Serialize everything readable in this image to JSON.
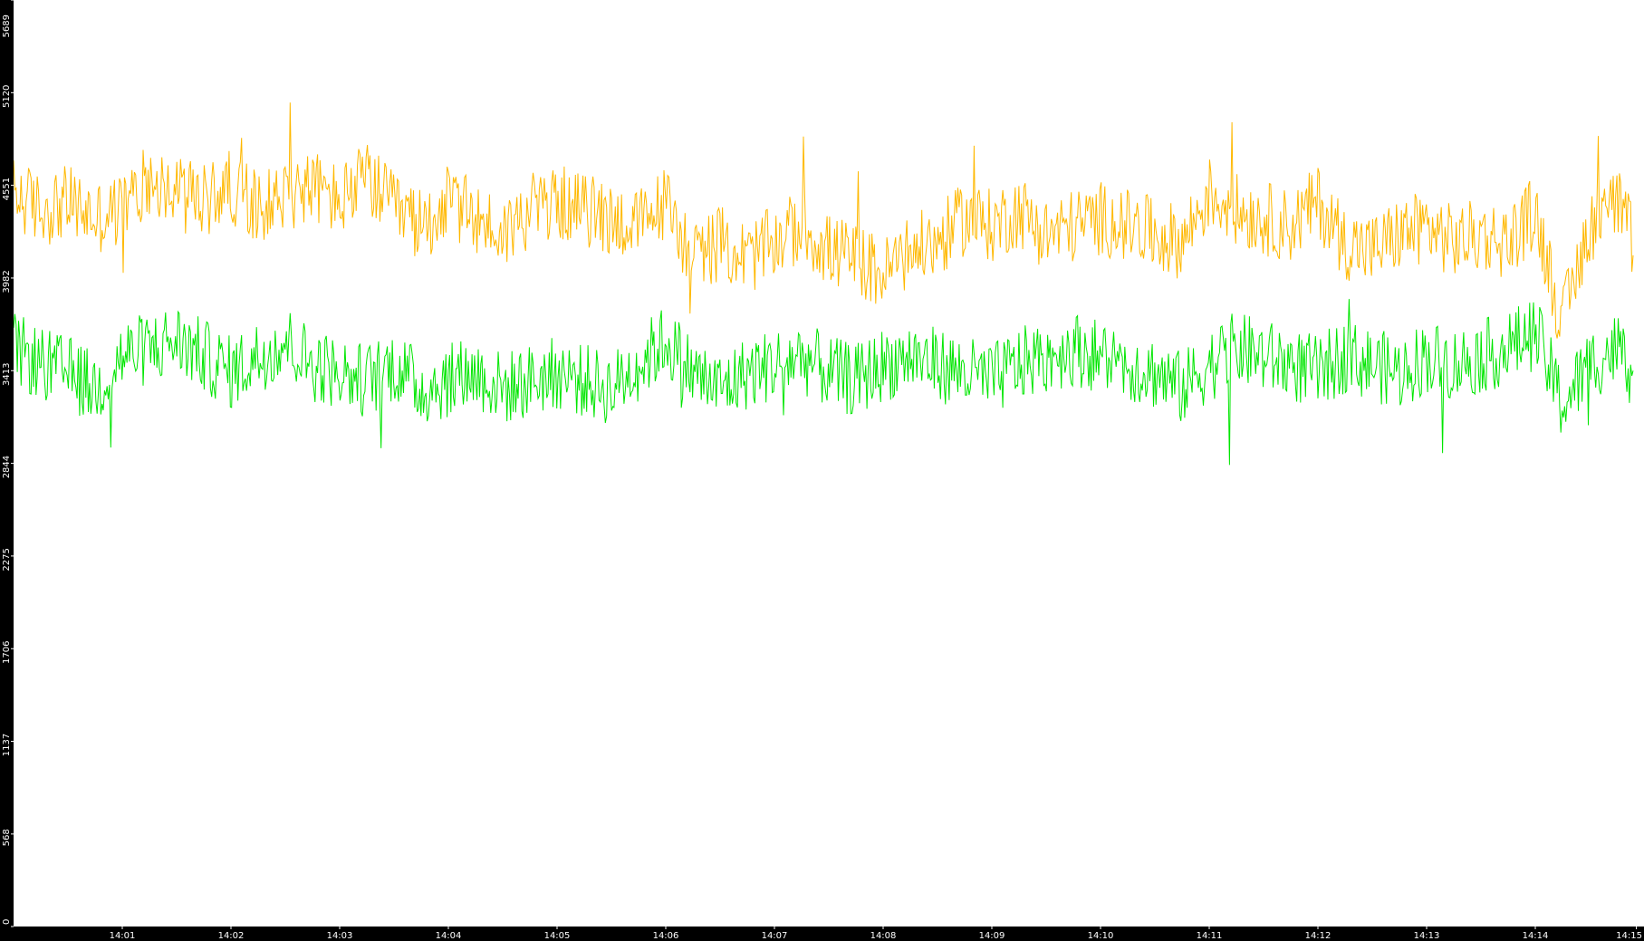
{
  "chart_data": {
    "type": "line",
    "title": "",
    "xlabel": "",
    "ylabel": "",
    "ylim": [
      0,
      5689
    ],
    "yticks": [
      0,
      568,
      1137,
      1706,
      2275,
      2844,
      3413,
      3982,
      4551,
      5120,
      5689
    ],
    "ytick_labels": [
      "0",
      "568",
      "1137",
      "1706",
      "2275",
      "2844",
      "3413",
      "3982",
      "4551",
      "5120",
      "5689"
    ],
    "x_range_minutes": [
      0,
      14.9
    ],
    "xticks_minutes": [
      1,
      2,
      3,
      4,
      5,
      6,
      7,
      8,
      9,
      10,
      11,
      12,
      13,
      14,
      14.93
    ],
    "xtick_labels": [
      "14:01",
      "14:02",
      "14:03",
      "14:04",
      "14:05",
      "14:06",
      "14:07",
      "14:08",
      "14:09",
      "14:10",
      "14:11",
      "14:12",
      "14:13",
      "14:14",
      "14:15"
    ],
    "grid": false,
    "legend": "none",
    "series": [
      {
        "color": "#ffb800",
        "x_minutes": [
          0,
          0.25,
          0.5,
          0.75,
          1,
          1.25,
          1.5,
          1.75,
          2,
          2.25,
          2.5,
          2.75,
          3,
          3.25,
          3.5,
          3.75,
          4,
          4.25,
          4.5,
          4.75,
          5,
          5.25,
          5.5,
          5.75,
          6,
          6.25,
          6.5,
          6.75,
          7,
          7.25,
          7.5,
          7.75,
          8,
          8.25,
          8.5,
          8.75,
          9,
          9.25,
          9.5,
          9.75,
          10,
          10.25,
          10.5,
          10.75,
          11,
          11.25,
          11.5,
          11.75,
          12,
          12.25,
          12.5,
          12.75,
          13,
          13.25,
          13.5,
          13.75,
          14,
          14.25,
          14.5,
          14.75,
          14.9
        ],
        "values": [
          4500,
          4400,
          4450,
          4350,
          4400,
          4600,
          4500,
          4450,
          4550,
          4400,
          4500,
          4550,
          4450,
          4600,
          4400,
          4300,
          4450,
          4350,
          4250,
          4400,
          4450,
          4400,
          4350,
          4300,
          4450,
          4100,
          4200,
          4100,
          4200,
          4300,
          4150,
          4100,
          4000,
          4150,
          4200,
          4350,
          4300,
          4400,
          4250,
          4300,
          4350,
          4300,
          4250,
          4200,
          4500,
          4400,
          4350,
          4300,
          4450,
          4200,
          4150,
          4250,
          4300,
          4200,
          4250,
          4200,
          4400,
          3700,
          4300,
          4450,
          4200
        ]
      },
      {
        "color": "#00e600",
        "x_minutes": [
          0,
          0.25,
          0.5,
          0.75,
          1,
          1.25,
          1.5,
          1.75,
          2,
          2.25,
          2.5,
          2.75,
          3,
          3.25,
          3.5,
          3.75,
          4,
          4.25,
          4.5,
          4.75,
          5,
          5.25,
          5.5,
          5.75,
          6,
          6.25,
          6.5,
          6.75,
          7,
          7.25,
          7.5,
          7.75,
          8,
          8.25,
          8.5,
          8.75,
          9,
          9.25,
          9.5,
          9.75,
          10,
          10.25,
          10.5,
          10.75,
          11,
          11.25,
          11.5,
          11.75,
          12,
          12.25,
          12.5,
          12.75,
          13,
          13.25,
          13.5,
          13.75,
          14,
          14.25,
          14.5,
          14.75,
          14.9
        ],
        "values": [
          3550,
          3450,
          3400,
          3300,
          3500,
          3550,
          3600,
          3500,
          3400,
          3500,
          3600,
          3450,
          3400,
          3350,
          3450,
          3300,
          3350,
          3400,
          3300,
          3350,
          3400,
          3350,
          3300,
          3450,
          3600,
          3400,
          3300,
          3400,
          3450,
          3500,
          3400,
          3350,
          3450,
          3500,
          3450,
          3400,
          3350,
          3450,
          3500,
          3550,
          3500,
          3450,
          3400,
          3300,
          3450,
          3550,
          3500,
          3450,
          3400,
          3500,
          3450,
          3400,
          3500,
          3450,
          3500,
          3550,
          3650,
          3200,
          3450,
          3550,
          3400
        ]
      }
    ]
  }
}
